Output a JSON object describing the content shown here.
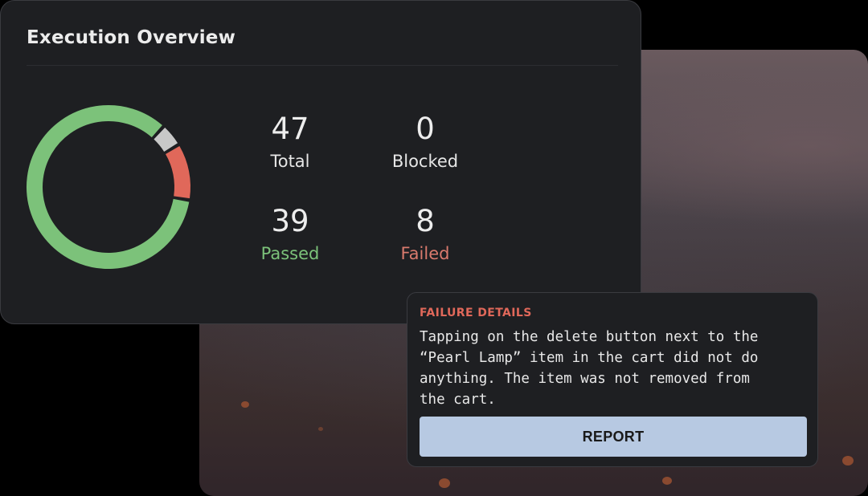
{
  "overview": {
    "title": "Execution Overview",
    "stats": {
      "total": {
        "value": "47",
        "label": "Total"
      },
      "blocked": {
        "value": "0",
        "label": "Blocked"
      },
      "passed": {
        "value": "39",
        "label": "Passed"
      },
      "failed": {
        "value": "8",
        "label": "Failed"
      }
    },
    "donut": {
      "segments": [
        {
          "name": "Passed",
          "value": 39,
          "color": "#7cc27a"
        },
        {
          "name": "Failed",
          "value": 8,
          "color": "#e0685a"
        },
        {
          "name": "Blocked",
          "value": 0,
          "color": "#c8c8c8"
        }
      ],
      "visible_blocked_sliver_color": "#c8c8c8"
    }
  },
  "failure": {
    "heading": "FAILURE DETAILS",
    "message": "Tapping on the delete button next to the\n“Pearl Lamp” item in the cart did not do\nanything. The item was not removed from\nthe cart.",
    "report_label": "REPORT"
  },
  "colors": {
    "card_bg": "#1e1f22",
    "passed": "#7cc27a",
    "failed": "#d97a6d",
    "failure_heading": "#e0685a",
    "button_bg": "#b7c9e2"
  }
}
